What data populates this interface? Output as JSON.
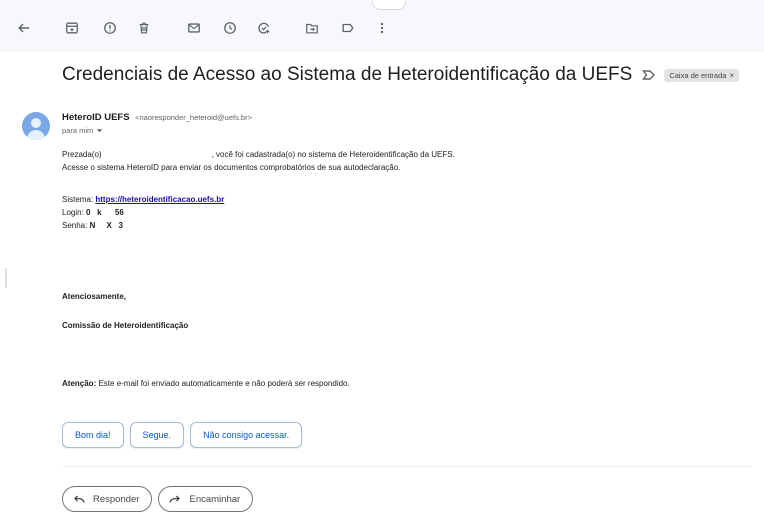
{
  "toolbar": {
    "icons": [
      "back-icon",
      "archive-icon",
      "report-spam-icon",
      "delete-icon",
      "mark-unread-icon",
      "snooze-icon",
      "add-task-icon",
      "move-to-icon",
      "label-icon",
      "more-options-icon"
    ]
  },
  "email": {
    "subject": "Credenciais de Acesso ao Sistema de Heteroidentificação da UEFS",
    "label": "Caixa de entrada",
    "label_close": "×",
    "sender_name": "HeteroID UEFS",
    "sender_email": "<naoresponder_heteroid@uefs.br>",
    "to": "para mim",
    "greeting_prefix": "Prezada(o)",
    "greeting_suffix": ", você foi cadastrada(o) no sistema de Heteroidentificação da UEFS.",
    "line2": "Acesse o sistema HeteroID para enviar os documentos comprobatórios de sua autodeclaração.",
    "system_label": "Sistema:",
    "system_url": "https://heteroidentificacao.uefs.br",
    "login_label": "Login:",
    "login_value": "0   k      56",
    "password_label": "Senha:",
    "password_value": "N     X   3",
    "closing": "Atenciosamente,",
    "signature": "Comissão de Heteroidentificação",
    "notice_label": "Atenção:",
    "notice_text": " Este e-mail foi enviado automaticamente e não poderá ser respondido."
  },
  "smart_replies": [
    "Bom dia!",
    "Segue.",
    "Não consigo acessar."
  ],
  "actions": {
    "reply": "Responder",
    "forward": "Encaminhar"
  },
  "colors": {
    "toolbar_bg": "#f6f8fc",
    "link": "#1a0dab",
    "chip_text": "#0b57d0",
    "avatar": "#7aa7e8"
  }
}
